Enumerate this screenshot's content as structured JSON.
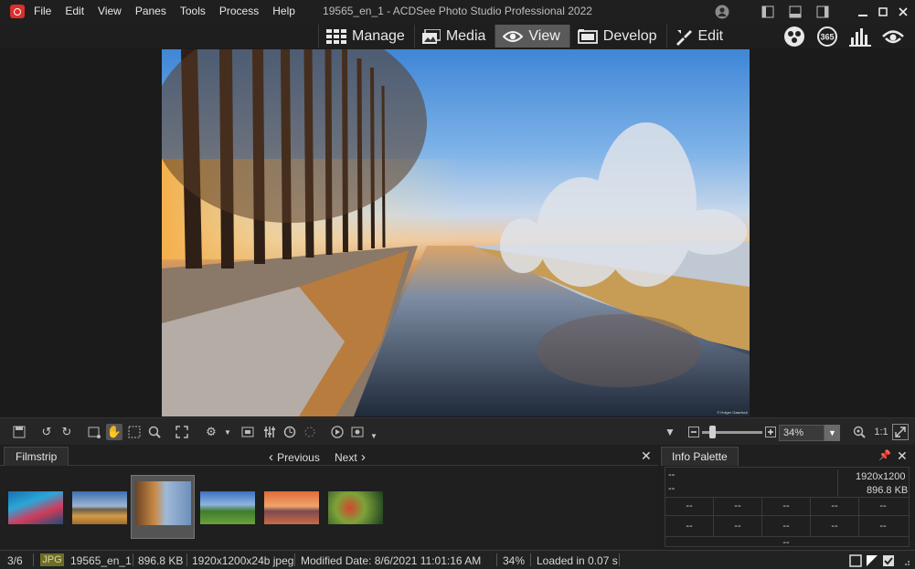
{
  "menu": [
    "File",
    "Edit",
    "View",
    "Panes",
    "Tools",
    "Process",
    "Help"
  ],
  "window_title": "19565_en_1 - ACDSee Photo Studio Professional 2022",
  "modes": [
    {
      "label": "Manage",
      "icon": "grid-icon"
    },
    {
      "label": "Media",
      "icon": "photos-icon"
    },
    {
      "label": "View",
      "icon": "eye-icon",
      "active": true
    },
    {
      "label": "Develop",
      "icon": "develop-icon"
    },
    {
      "label": "Edit",
      "icon": "edit-brush-icon"
    }
  ],
  "mode_extra_icons": [
    "people-icon",
    "365-icon",
    "dashboard-icon",
    "luxea-eye-icon"
  ],
  "photo": {
    "credit": "© Holger Gawrisch"
  },
  "toolbar": {
    "zoom_value": "34%",
    "actual_size": "1:1"
  },
  "filmstrip": {
    "tab": "Filmstrip",
    "previous": "Previous",
    "next": "Next",
    "thumb_count": 6,
    "selected_index": 2
  },
  "info_palette": {
    "tab": "Info Palette",
    "row1_left": "--",
    "row1_right": "1920x1200",
    "row2_left": "--",
    "row2_right": "896.8 KB",
    "grid_row1": [
      "--",
      "--",
      "--",
      "--",
      "--"
    ],
    "grid_row2": [
      "--",
      "--",
      "--",
      "--",
      "--"
    ],
    "footer": "--"
  },
  "status": {
    "position": "3/6",
    "type": "JPG",
    "filename": "19565_en_1",
    "size": "896.8 KB",
    "dims": "1920x1200x24b jpeg",
    "modified": "Modified Date: 8/6/2021 11:01:16 AM",
    "zoom": "34%",
    "loaded": "Loaded in 0.07 s"
  },
  "colors": {
    "active_mode": "#5a5a5a",
    "app_red": "#d9302c",
    "jpg_badge": "#6d6d2a"
  }
}
